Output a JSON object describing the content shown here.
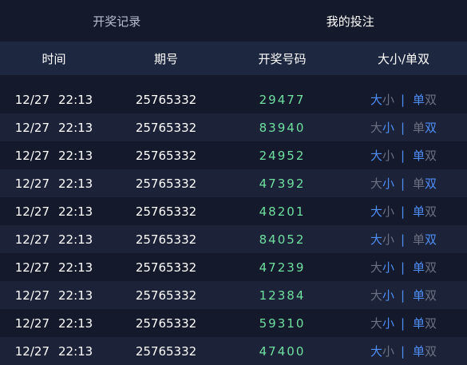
{
  "tabs": [
    {
      "label": "开奖记录",
      "active": false
    },
    {
      "label": "我的投注",
      "active": true
    }
  ],
  "columns": [
    "时间",
    "期号",
    "开奖号码",
    "大小/单双"
  ],
  "labels": {
    "big": "大",
    "small": "小",
    "odd": "单",
    "even": "双",
    "sep": "|"
  },
  "colors": {
    "highlight": "#4f8df7",
    "dim": "#6b7183",
    "number": "#6fe0a0"
  },
  "rows": [
    {
      "date": "12/27",
      "time": "22:13",
      "period": "25765332",
      "number": "29477",
      "size": "big",
      "parity": "odd"
    },
    {
      "date": "12/27",
      "time": "22:13",
      "period": "25765332",
      "number": "83940",
      "size": "small",
      "parity": "even"
    },
    {
      "date": "12/27",
      "time": "22:13",
      "period": "25765332",
      "number": "24952",
      "size": "big",
      "parity": "odd"
    },
    {
      "date": "12/27",
      "time": "22:13",
      "period": "25765332",
      "number": "47392",
      "size": "small",
      "parity": "even"
    },
    {
      "date": "12/27",
      "time": "22:13",
      "period": "25765332",
      "number": "48201",
      "size": "big",
      "parity": "odd"
    },
    {
      "date": "12/27",
      "time": "22:13",
      "period": "25765332",
      "number": "84052",
      "size": "big",
      "parity": "even"
    },
    {
      "date": "12/27",
      "time": "22:13",
      "period": "25765332",
      "number": "47239",
      "size": "small",
      "parity": "odd"
    },
    {
      "date": "12/27",
      "time": "22:13",
      "period": "25765332",
      "number": "12384",
      "size": "small",
      "parity": "odd"
    },
    {
      "date": "12/27",
      "time": "22:13",
      "period": "25765332",
      "number": "59310",
      "size": "small",
      "parity": "odd"
    },
    {
      "date": "12/27",
      "time": "22:13",
      "period": "25765332",
      "number": "47400",
      "size": "big",
      "parity": "odd"
    }
  ]
}
